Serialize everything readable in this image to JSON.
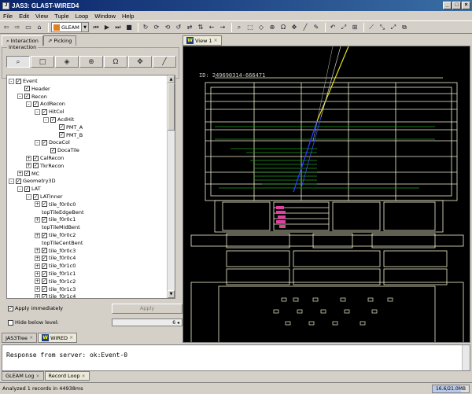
{
  "window": {
    "title": "JAS3: GLAST-WIRED4"
  },
  "menu": [
    "File",
    "Edit",
    "View",
    "Tuple",
    "Loop",
    "Window",
    "Help"
  ],
  "toolbar": {
    "source_combo": "GLEAM"
  },
  "left_tabs": {
    "interaction": "Interaction",
    "picking": "Picking"
  },
  "interaction_group": {
    "title": "Interaction"
  },
  "tree": [
    {
      "label": "Event",
      "level": 0,
      "exp": "-",
      "chk": true
    },
    {
      "label": "Header",
      "level": 1,
      "exp": "",
      "chk": true
    },
    {
      "label": "Recon",
      "level": 1,
      "exp": "-",
      "chk": true
    },
    {
      "label": "AcdRecon",
      "level": 2,
      "exp": "-",
      "chk": true
    },
    {
      "label": "HitCol",
      "level": 3,
      "exp": "-",
      "chk": true
    },
    {
      "label": "AcdHit",
      "level": 4,
      "exp": "-",
      "chk": true
    },
    {
      "label": "PMT_A",
      "level": 5,
      "exp": "",
      "chk": true
    },
    {
      "label": "PMT_B",
      "level": 5,
      "exp": "",
      "chk": true
    },
    {
      "label": "DocaCol",
      "level": 3,
      "exp": "-",
      "chk": true
    },
    {
      "label": "DocaTile",
      "level": 4,
      "exp": "",
      "chk": true
    },
    {
      "label": "CalRecon",
      "level": 2,
      "exp": "+",
      "chk": true
    },
    {
      "label": "TkrRecon",
      "level": 2,
      "exp": "+",
      "chk": true
    },
    {
      "label": "MC",
      "level": 1,
      "exp": "+",
      "chk": true
    },
    {
      "label": "Geometry3D",
      "level": 0,
      "exp": "-",
      "chk": true
    },
    {
      "label": "LAT",
      "level": 1,
      "exp": "-",
      "chk": true
    },
    {
      "label": "LATInner",
      "level": 2,
      "exp": "-",
      "chk": true
    },
    {
      "label": "tile_f0r0c0",
      "level": 3,
      "exp": "+",
      "chk": true
    },
    {
      "label": "topTileEdgeBent",
      "level": 3,
      "exp": "",
      "chk": false
    },
    {
      "label": "tile_f0r0c1",
      "level": 3,
      "exp": "+",
      "chk": true
    },
    {
      "label": "topTileMidBent",
      "level": 3,
      "exp": "",
      "chk": false
    },
    {
      "label": "tile_f0r0c2",
      "level": 3,
      "exp": "+",
      "chk": true
    },
    {
      "label": "topTileCentBent",
      "level": 3,
      "exp": "",
      "chk": false
    },
    {
      "label": "tile_f0r0c3",
      "level": 3,
      "exp": "+",
      "chk": true
    },
    {
      "label": "tile_f0r0c4",
      "level": 3,
      "exp": "+",
      "chk": true
    },
    {
      "label": "tile_f0r1c0",
      "level": 3,
      "exp": "+",
      "chk": true
    },
    {
      "label": "tile_f0r1c1",
      "level": 3,
      "exp": "+",
      "chk": true
    },
    {
      "label": "tile_f0r1c2",
      "level": 3,
      "exp": "+",
      "chk": true
    },
    {
      "label": "tile_f0r1c3",
      "level": 3,
      "exp": "+",
      "chk": true
    },
    {
      "label": "tile_f0r1c4",
      "level": 3,
      "exp": "+",
      "chk": true
    }
  ],
  "apply": {
    "checkbox_label": "Apply immediately",
    "checked": true,
    "button": "Apply"
  },
  "hide": {
    "checkbox_label": "Hide below level:",
    "checked": false,
    "value": "6"
  },
  "left_bottom_tabs": {
    "tree": "JAS3Tree",
    "wired": "WIRED"
  },
  "view_tab": "View 1",
  "event_id": "ID: 249690314-666471",
  "console": {
    "text": "Response from server: ok:Event-0"
  },
  "console_tabs": {
    "log": "GLEAM Log",
    "loop": "Record Loop"
  },
  "status": {
    "text": "Analyzed 1 records in 44938ms",
    "memory": "16.6/21.0MB",
    "memory_fraction": 0.79
  },
  "colors": {
    "title_bar": "#0a246a",
    "viewport_bg": "#000000",
    "detector_lines": "#f0f0d0",
    "track_yellow": "#e8e020",
    "track_blue": "#2040ff",
    "track_green": "#20a020",
    "hits_magenta": "#e040a0"
  }
}
